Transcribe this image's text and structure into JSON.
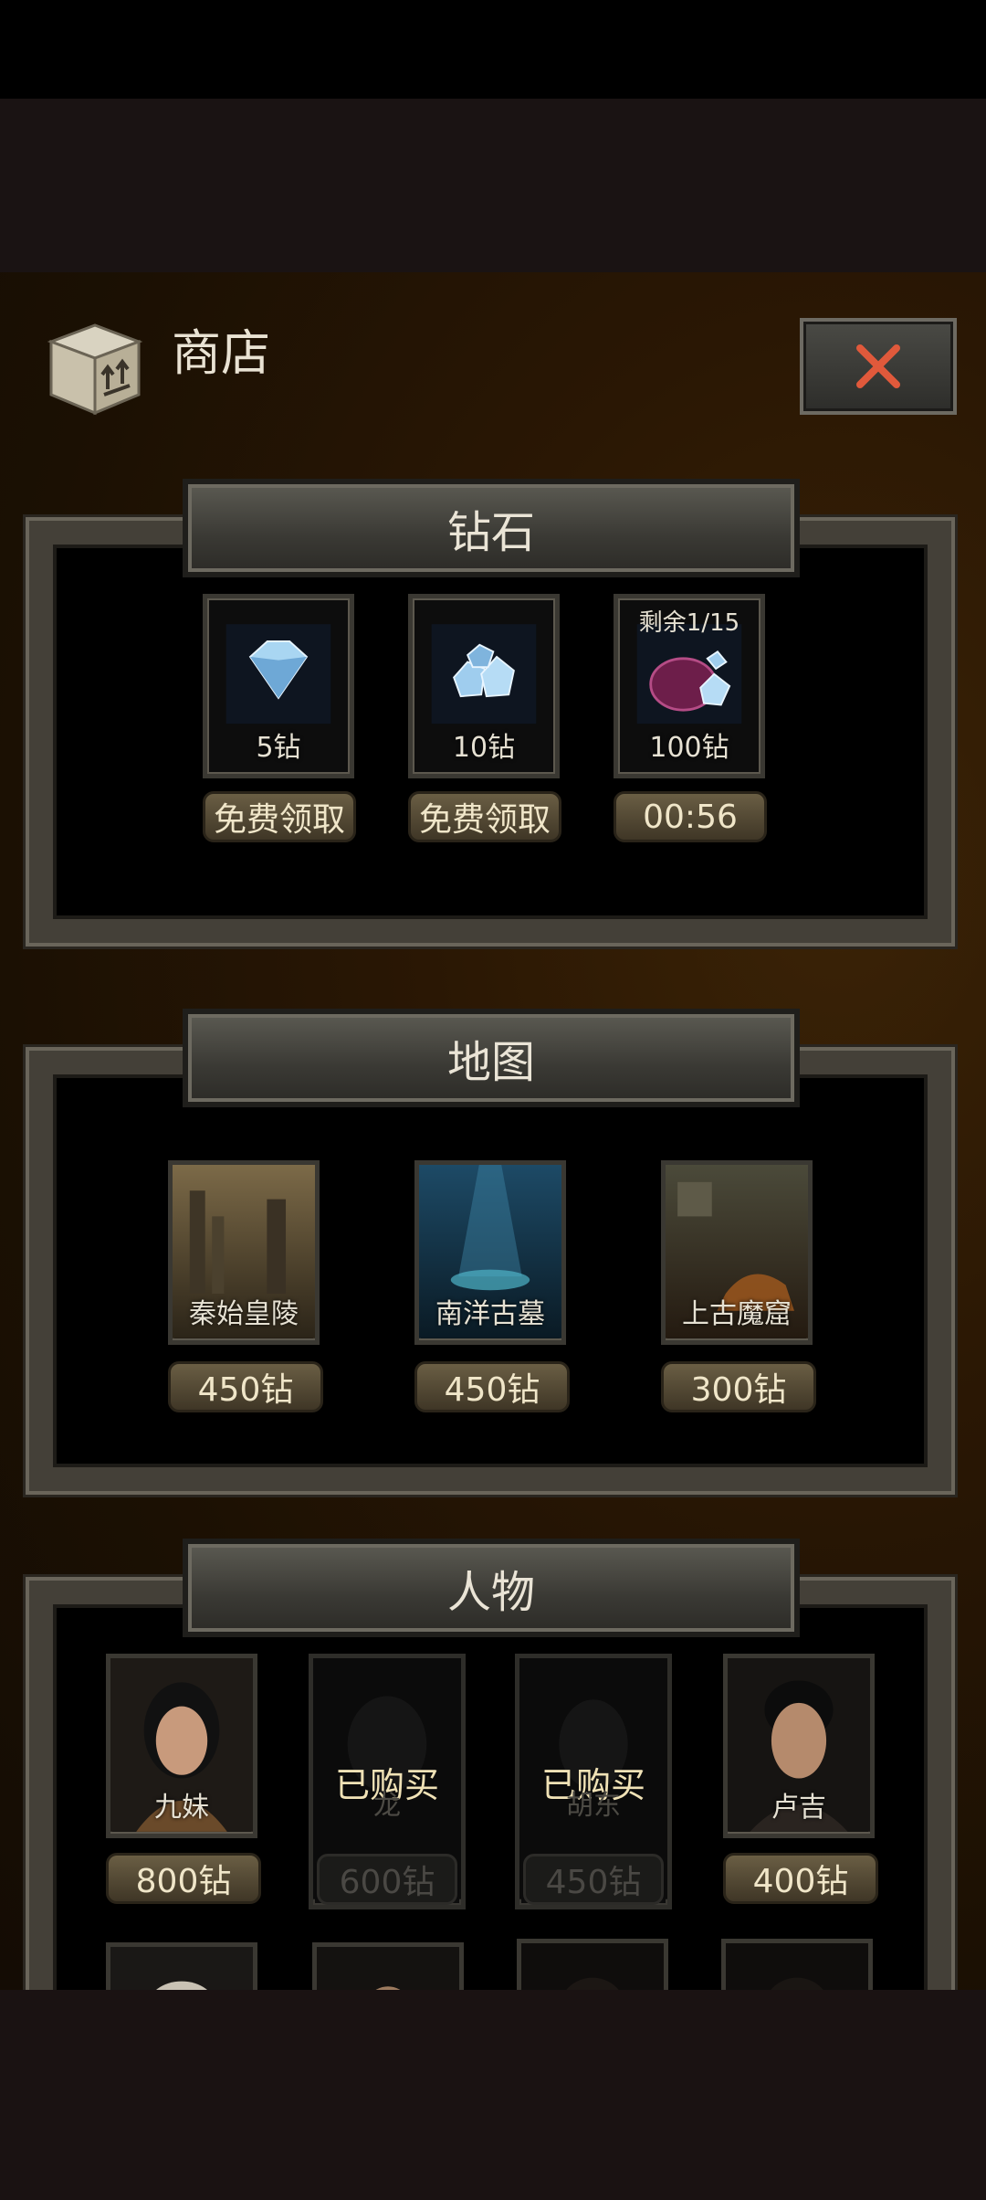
{
  "shop": {
    "title": "商店"
  },
  "sections": {
    "diamond": {
      "title": "钻石",
      "items": [
        {
          "label": "5钻",
          "action": "免费领取"
        },
        {
          "label": "10钻",
          "action": "免费领取"
        },
        {
          "label": "100钻",
          "remaining": "剩余1/15",
          "timer": "00:56"
        }
      ]
    },
    "map": {
      "title": "地图",
      "items": [
        {
          "label": "秦始皇陵",
          "price": "450钻"
        },
        {
          "label": "南洋古墓",
          "price": "450钻"
        },
        {
          "label": "上古魔窟",
          "price": "300钻"
        }
      ]
    },
    "character": {
      "title": "人物",
      "items": [
        {
          "label": "九妹",
          "price": "800钻"
        },
        {
          "label": "龙",
          "price": "600钻",
          "status": "已购买"
        },
        {
          "label": "胡东",
          "price": "450钻",
          "status": "已购买"
        },
        {
          "label": "卢吉",
          "price": "400钻"
        }
      ]
    }
  },
  "colors": {
    "accent": "#e0593b",
    "pill": "#5a5040",
    "frame": "#444038"
  }
}
